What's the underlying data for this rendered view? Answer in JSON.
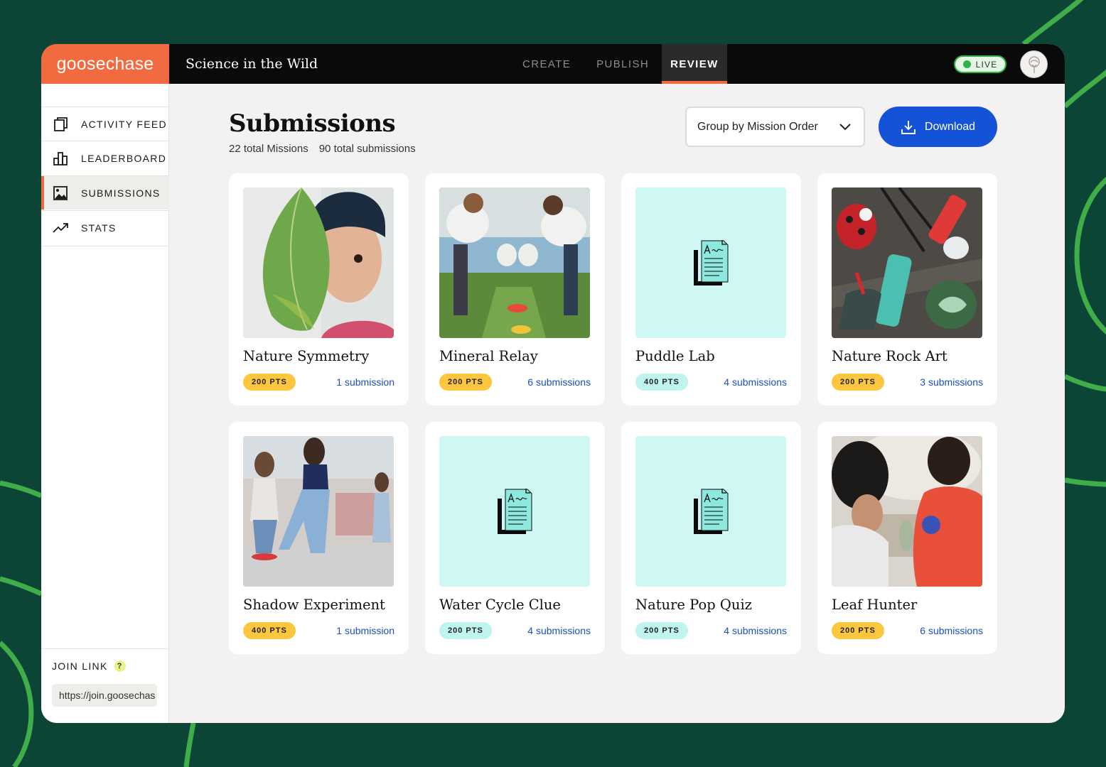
{
  "app": {
    "logo": "goosechase",
    "project_title": "Science in the Wild",
    "tabs": [
      {
        "label": "CREATE",
        "active": false
      },
      {
        "label": "PUBLISH",
        "active": false
      },
      {
        "label": "REVIEW",
        "active": true
      }
    ],
    "live_badge": "LIVE",
    "colors": {
      "brand": "#f26a3f",
      "accent": "#1452d8",
      "live": "#2db34a",
      "background": "#0c4535"
    }
  },
  "sidebar": {
    "items": [
      {
        "label": "ACTIVITY FEED",
        "icon": "activity-feed-icon",
        "active": false
      },
      {
        "label": "LEADERBOARD",
        "icon": "leaderboard-icon",
        "active": false
      },
      {
        "label": "SUBMISSIONS",
        "icon": "image-icon",
        "active": true
      },
      {
        "label": "STATS",
        "icon": "trending-up-icon",
        "active": false
      }
    ],
    "join_link": {
      "label": "JOIN LINK",
      "help": "?",
      "value": "https://join.goosechas"
    }
  },
  "main": {
    "title": "Submissions",
    "total_missions": "22 total Missions",
    "total_submissions": "90 total submissions",
    "group_by": "Group by Mission Order",
    "download_label": "Download"
  },
  "missions": [
    {
      "title": "Nature Symmetry",
      "points": "200 PTS",
      "points_color": "yellow",
      "submissions": "1 submission",
      "thumb": "photo-leaf-kid"
    },
    {
      "title": "Mineral Relay",
      "points": "200 PTS",
      "points_color": "yellow",
      "submissions": "6 submissions",
      "thumb": "photo-relay"
    },
    {
      "title": "Puddle Lab",
      "points": "400 PTS",
      "points_color": "mint",
      "submissions": "4 submissions",
      "thumb": "text-mission-icon"
    },
    {
      "title": "Nature Rock Art",
      "points": "200 PTS",
      "points_color": "yellow",
      "submissions": "3 submissions",
      "thumb": "photo-rock-art"
    },
    {
      "title": "Shadow Experiment",
      "points": "400 PTS",
      "points_color": "yellow",
      "submissions": "1 submission",
      "thumb": "photo-shadow"
    },
    {
      "title": "Water Cycle Clue",
      "points": "200 PTS",
      "points_color": "mint",
      "submissions": "4 submissions",
      "thumb": "text-mission-icon"
    },
    {
      "title": "Nature Pop Quiz",
      "points": "200 PTS",
      "points_color": "mint",
      "submissions": "4 submissions",
      "thumb": "text-mission-icon"
    },
    {
      "title": "Leaf Hunter",
      "points": "200 PTS",
      "points_color": "yellow",
      "submissions": "6 submissions",
      "thumb": "photo-leaf-hunter"
    }
  ]
}
